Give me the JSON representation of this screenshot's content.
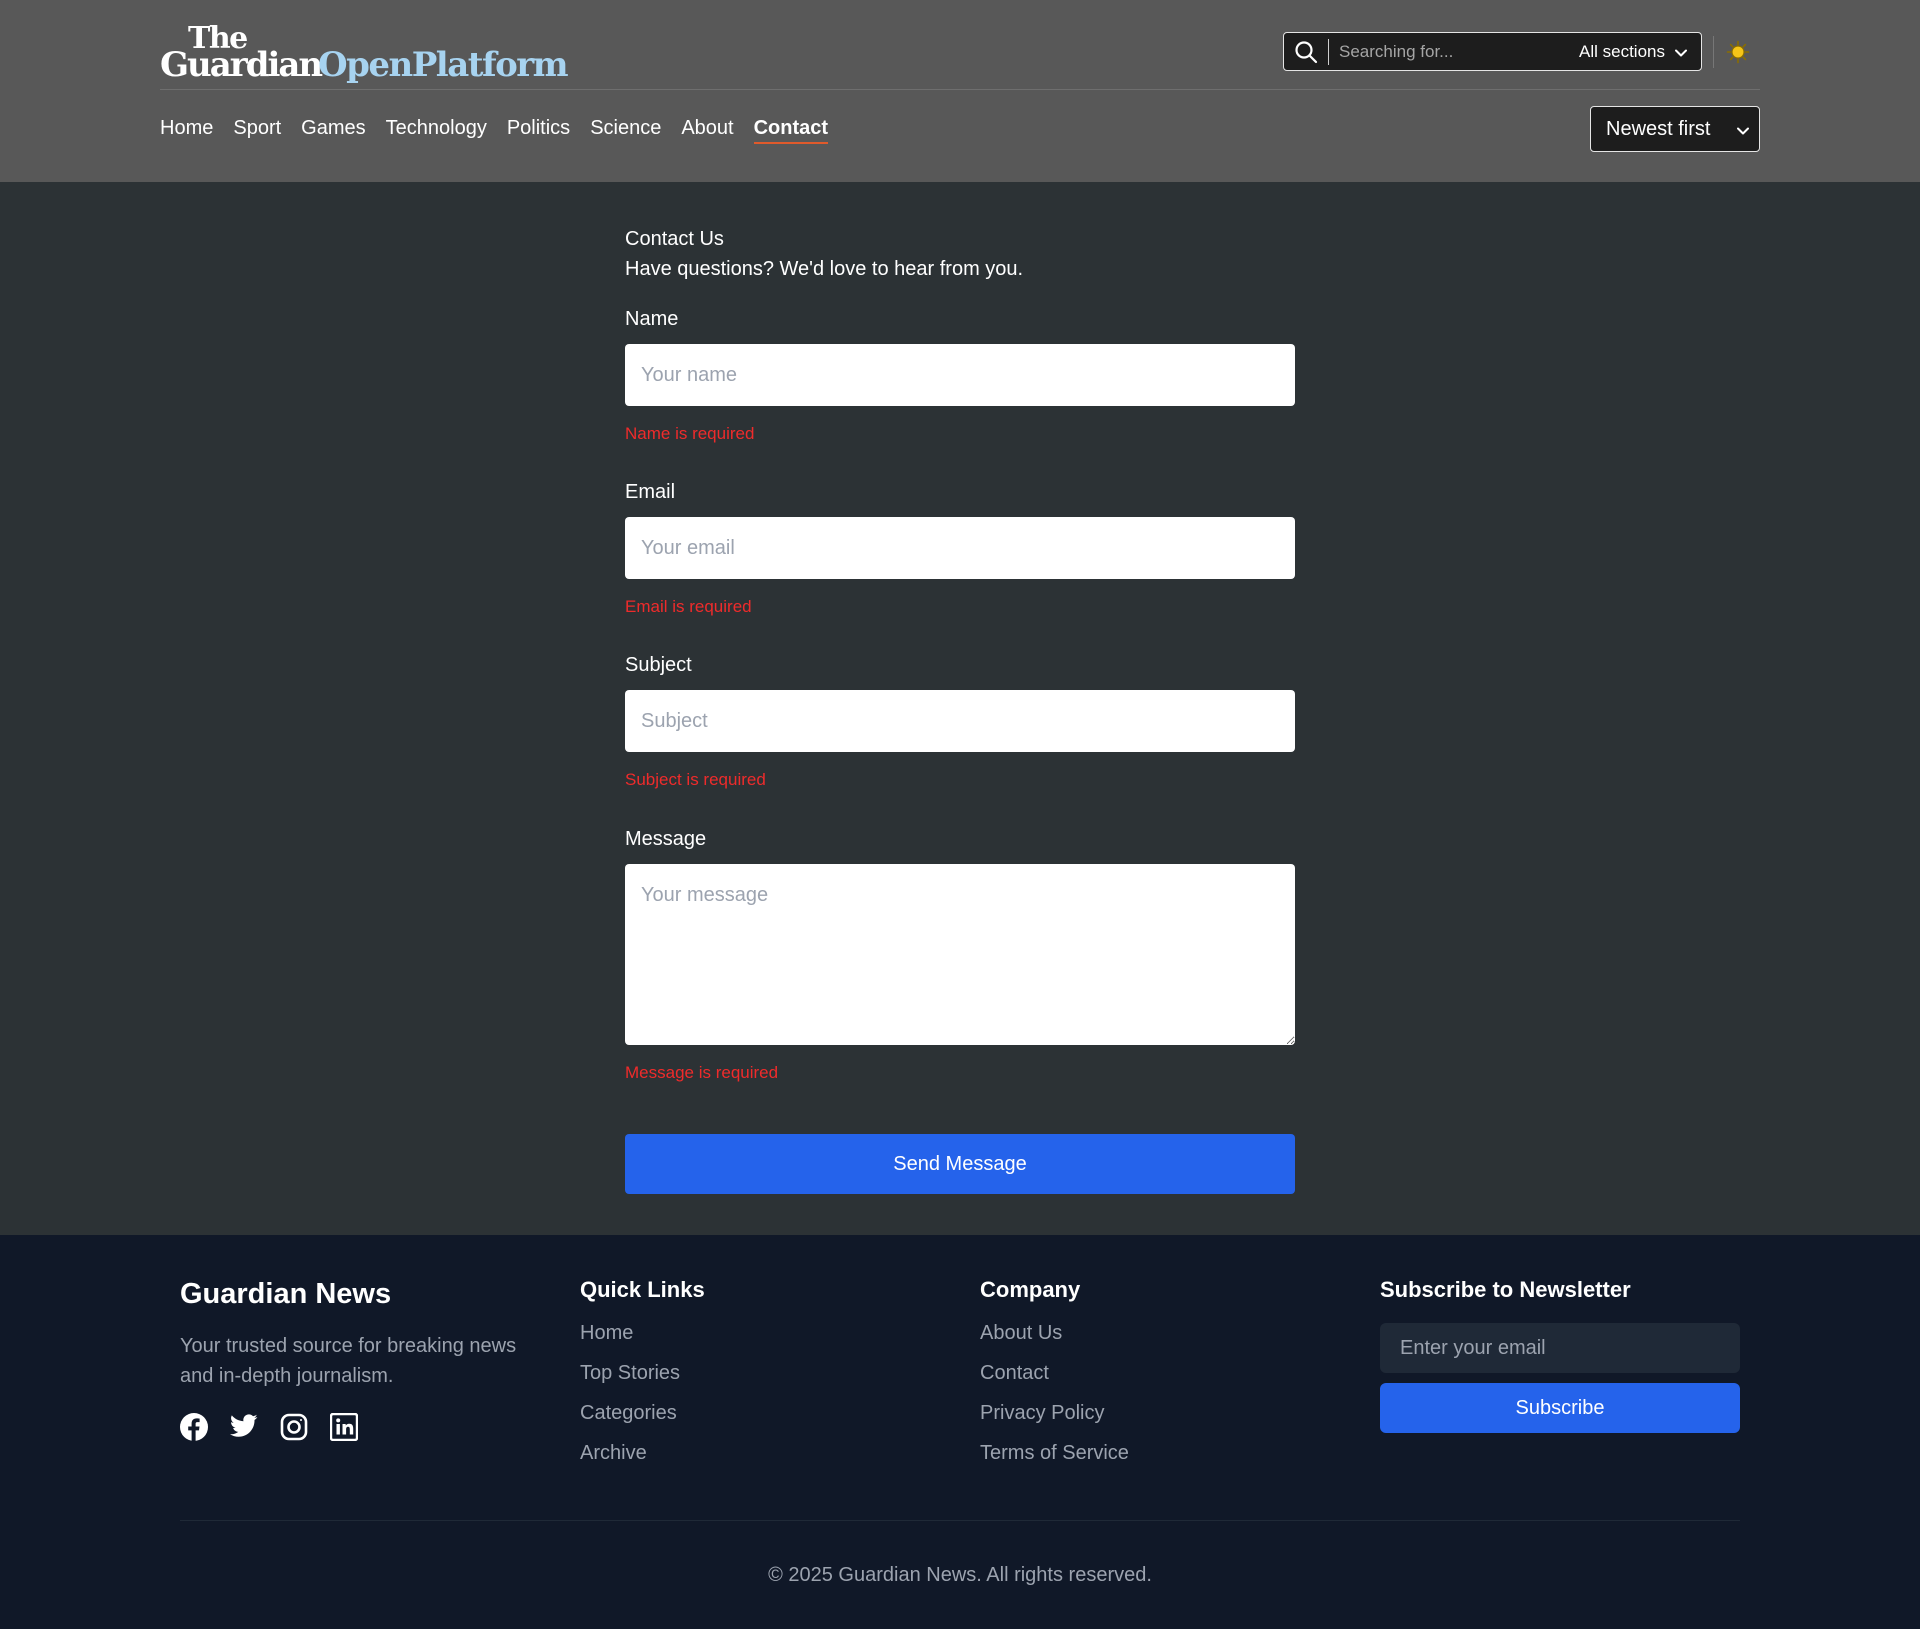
{
  "header": {
    "logo": {
      "the": "The",
      "guardian": "Guardian",
      "open_platform": "OpenPlatform"
    },
    "search": {
      "placeholder": "Searching for...",
      "value": "",
      "section": "All sections"
    },
    "nav": [
      {
        "label": "Home"
      },
      {
        "label": "Sport"
      },
      {
        "label": "Games"
      },
      {
        "label": "Technology"
      },
      {
        "label": "Politics"
      },
      {
        "label": "Science"
      },
      {
        "label": "About"
      },
      {
        "label": "Contact",
        "active": true
      }
    ],
    "sort": "Newest first",
    "icons": {
      "search": "search-icon",
      "theme": "sun-icon",
      "chevron": "chevron-down-icon"
    }
  },
  "contact": {
    "heading": "Contact Us",
    "subheading": "Have questions? We'd love to hear from you.",
    "fields": {
      "name": {
        "label": "Name",
        "placeholder": "Your name",
        "value": "",
        "error": "Name is required"
      },
      "email": {
        "label": "Email",
        "placeholder": "Your email",
        "value": "",
        "error": "Email is required"
      },
      "subject": {
        "label": "Subject",
        "placeholder": "Subject",
        "value": "",
        "error": "Subject is required"
      },
      "message": {
        "label": "Message",
        "placeholder": "Your message",
        "value": "",
        "error": "Message is required"
      }
    },
    "submit_label": "Send Message"
  },
  "footer": {
    "brand": "Guardian News",
    "description": "Your trusted source for breaking news and in-depth journalism.",
    "social_icons": [
      "facebook-icon",
      "twitter-icon",
      "instagram-icon",
      "linkedin-icon"
    ],
    "quick_links": {
      "title": "Quick Links",
      "items": [
        "Home",
        "Top Stories",
        "Categories",
        "Archive"
      ]
    },
    "company": {
      "title": "Company",
      "items": [
        "About Us",
        "Contact",
        "Privacy Policy",
        "Terms of Service"
      ]
    },
    "newsletter": {
      "title": "Subscribe to Newsletter",
      "placeholder": "Enter your email",
      "button": "Subscribe"
    },
    "copyright": "© 2025 Guardian News. All rights reserved."
  },
  "colors": {
    "header_bg": "#585858",
    "main_bg": "#2c3235",
    "footer_bg": "#101828",
    "accent": "#2563eb",
    "error": "#ef2b2b",
    "nav_active_underline": "#e05a2b",
    "logo_open_platform": "#a7d3f0",
    "theme_icon": "#f5c518"
  }
}
